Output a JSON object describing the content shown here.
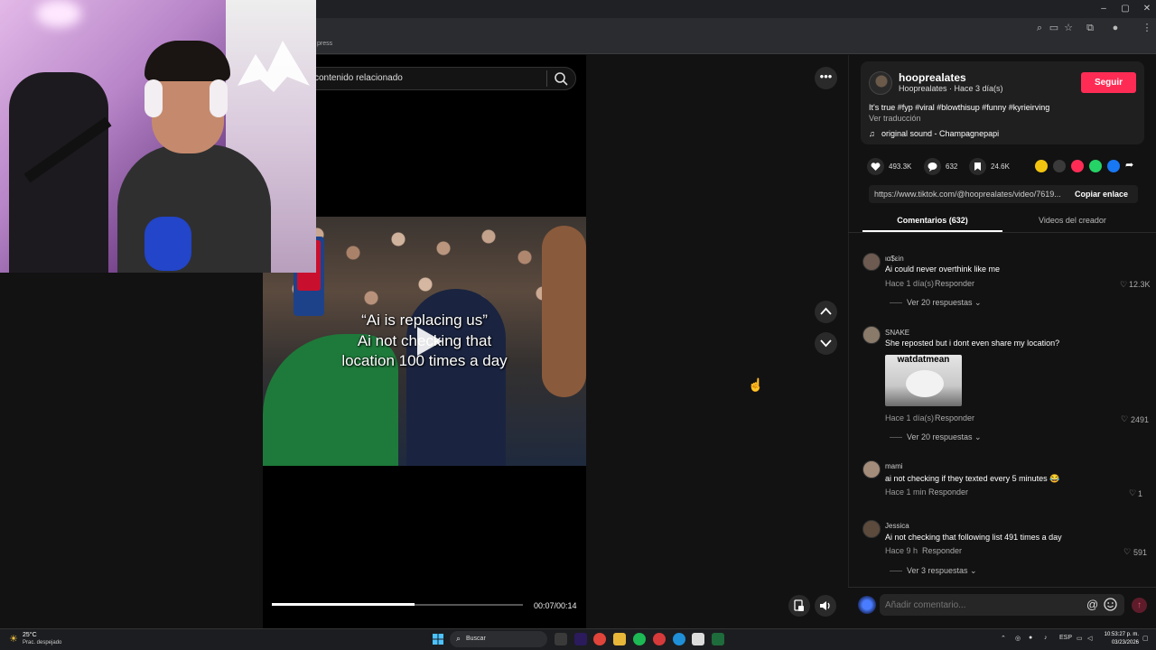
{
  "browser": {
    "bookmark_partial": "press",
    "window_controls": [
      "–",
      "▢",
      "✕"
    ],
    "toolbar_icons": [
      "zoom-icon",
      "cast-icon",
      "star-icon",
      "extensions-icon",
      "profile-icon",
      "menu-icon"
    ]
  },
  "search": {
    "placeholder": "contenido relacionado"
  },
  "video": {
    "caption_lines": [
      "“Ai is replacing us”",
      "Ai not checking that",
      "location 100 times a day"
    ],
    "progress_fraction": 0.57,
    "time": "00:07/00:14"
  },
  "author": {
    "username": "hooprealates",
    "subline": "Hooprealates · Hace 3 día(s)",
    "follow_label": "Seguir",
    "description": "It's true #fyp #viral #blowthisup #funny #kyrieirving",
    "translate_label": "Ver traducción",
    "sound_icon": "♫",
    "sound": "original sound - Champagnepapi"
  },
  "stats": {
    "likes": "493.3K",
    "comments": "632",
    "saves": "24.6K"
  },
  "share_colors": [
    "#f2c40f",
    "#3a3a3a",
    "#fe2c55",
    "#25d366",
    "#1877f2"
  ],
  "link": {
    "url": "https://www.tiktok.com/@hooprealates/video/7619...",
    "copy_label": "Copiar enlace"
  },
  "tabs": {
    "comments": "Comentarios (632)",
    "creator": "Videos del creador"
  },
  "comments": [
    {
      "user": "ια$εin",
      "text": "Ai could never overthink like me",
      "time": "Hace 1 día(s)",
      "reply": "Responder",
      "likes": "12.3K",
      "more": "Ver 20 respuestas ⌄"
    },
    {
      "user": "SNAKE",
      "text": "She reposted but i dont even share my location?",
      "image_text": "watdatmean",
      "time": "Hace 1 día(s)",
      "reply": "Responder",
      "likes": "2491",
      "more": "Ver 20 respuestas ⌄"
    },
    {
      "user": "mami",
      "text": "ai not checking if they texted every 5 minutes 😂",
      "time": "Hace 1 min",
      "reply": "Responder",
      "likes": "1"
    },
    {
      "user": "Jessica",
      "text": "Ai not checking that following list 491 times a day",
      "time": "Hace 9 h",
      "reply": "Responder",
      "likes": "591",
      "more": "Ver 3 respuestas ⌄"
    }
  ],
  "comment_input": {
    "placeholder": "Añadir comentario...",
    "at_symbol": "@",
    "send_symbol": "↑"
  },
  "taskbar": {
    "weather_temp": "25°C",
    "weather_desc": "Prac. despejado",
    "search_label": "Buscar",
    "lang": "ESP",
    "time": "10:53:27 p. m.",
    "date": "03/23/2026"
  }
}
